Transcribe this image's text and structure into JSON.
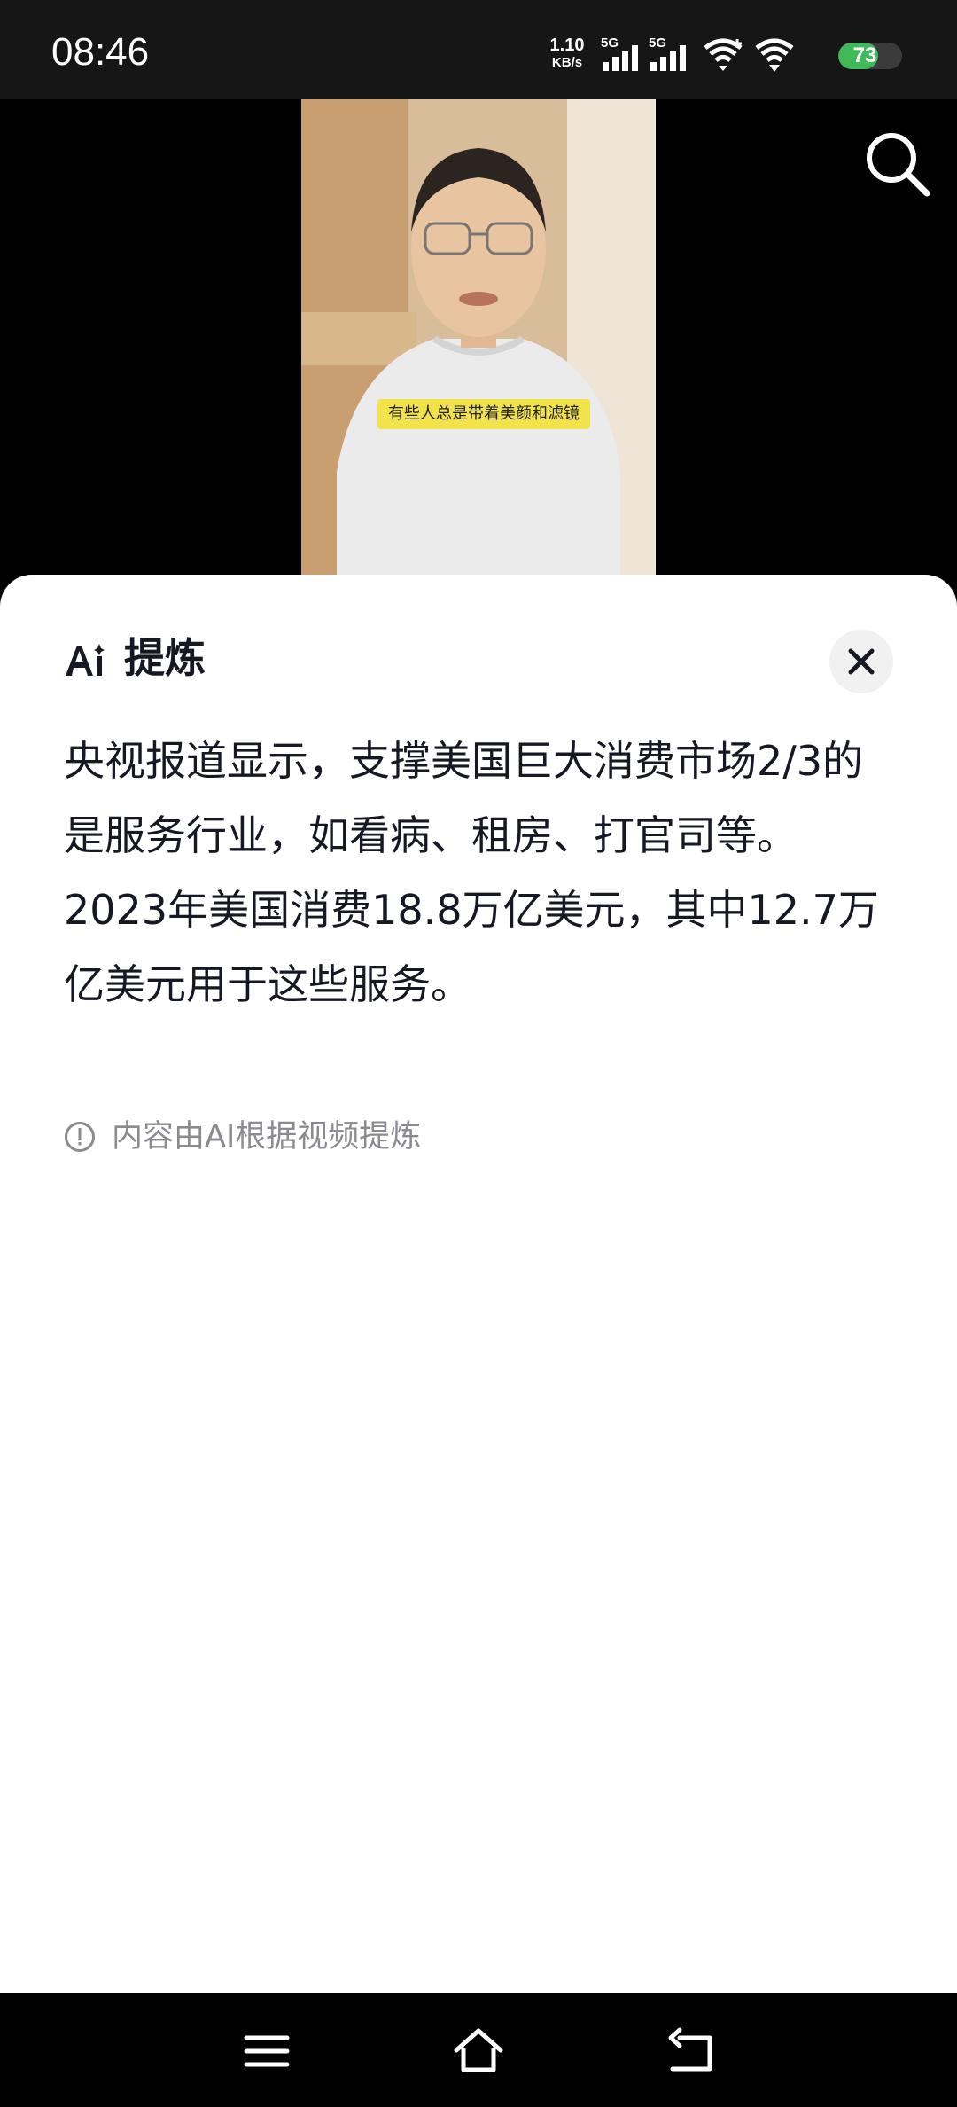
{
  "status_bar": {
    "time": "08:46",
    "net_speed_value": "1.10",
    "net_speed_unit": "KB/s",
    "sim1_label": "5G",
    "sim2_label": "5G",
    "battery_level": "73",
    "battery_color": "#3fb95a",
    "icons": [
      "signal-icon",
      "signal-icon",
      "wifi-icon",
      "wifi-icon",
      "battery-icon"
    ]
  },
  "video": {
    "subtitle": "有些人总是带着美颜和滤镜",
    "search_icon": "search-icon"
  },
  "sheet": {
    "ai_icon": "ai-icon",
    "title": "提炼",
    "close_icon": "close-icon",
    "summary": "央视报道显示，支撑美国巨大消费市场2/3的是服务行业，如看病、租房、打官司等。2023年美国消费18.8万亿美元，其中12.7万亿美元用于这些服务。",
    "disclaimer_icon": "info-icon",
    "disclaimer": "内容由AI根据视频提炼"
  },
  "nav_bar": {
    "icons": [
      "menu-icon",
      "home-icon",
      "back-icon"
    ]
  }
}
